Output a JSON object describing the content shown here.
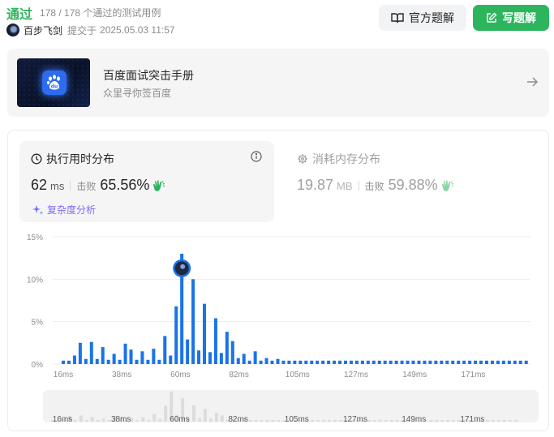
{
  "header": {
    "status": "通过",
    "cases": "178 / 178 个通过的测试用例",
    "username": "百步飞剑",
    "submit_label": "提交于",
    "submit_time": "2025.05.03 11:57",
    "official_solution": "官方题解",
    "write_solution": "写题解"
  },
  "banner": {
    "title": "百度面试突击手册",
    "subtitle": "众里寻你签百度",
    "logo_text": "du"
  },
  "runtime": {
    "title": "执行用时分布",
    "value": "62",
    "unit": "ms",
    "beat_label": "击败",
    "beat_value": "65.56%",
    "complexity": "复杂度分析"
  },
  "memory": {
    "title": "消耗内存分布",
    "value": "19.87",
    "unit": "MB",
    "beat_label": "击败",
    "beat_value": "59.88%"
  },
  "colors": {
    "green": "#2db55d",
    "bar": "#1a73e8",
    "purple": "#7b6cf6"
  },
  "chart_data": {
    "type": "bar",
    "y_ticks": [
      "15%",
      "10%",
      "5%",
      "0%"
    ],
    "ylim": [
      0,
      15
    ],
    "x_ticks": [
      "16ms",
      "38ms",
      "60ms",
      "82ms",
      "105ms",
      "127ms",
      "149ms",
      "171ms"
    ],
    "values": [
      0.4,
      0.4,
      1.0,
      2.5,
      0.6,
      2.6,
      0.6,
      2.0,
      0.5,
      1.2,
      0.5,
      2.4,
      1.7,
      0.5,
      1.5,
      0.5,
      1.8,
      0.5,
      3.3,
      1.0,
      6.8,
      13.0,
      2.9,
      10.0,
      1.6,
      7.1,
      1.4,
      5.4,
      1.3,
      3.8,
      2.7,
      0.7,
      1.2,
      0.4,
      1.5,
      0.4,
      0.7,
      0.4,
      0.6,
      0.4,
      0.4,
      0.4,
      0.4,
      0.4,
      0.4,
      0.4,
      0.4,
      0.4,
      0.4,
      0.4,
      0.4,
      0.4,
      0.4,
      0.4,
      0.4,
      0.4,
      0.4,
      0.4,
      0.4,
      0.4,
      0.4,
      0.4,
      0.4,
      0.4,
      0.4,
      0.4,
      0.4,
      0.4,
      0.4,
      0.4,
      0.4,
      0.4,
      0.4,
      0.4,
      0.4,
      0.4,
      0.4,
      0.4,
      0.4,
      0.4,
      0.4,
      0.4,
      0.4
    ],
    "highlight_index": 21,
    "overview_x_ticks": [
      "16ms",
      "38ms",
      "60ms",
      "82ms",
      "105ms",
      "127ms",
      "149ms",
      "171ms"
    ]
  }
}
